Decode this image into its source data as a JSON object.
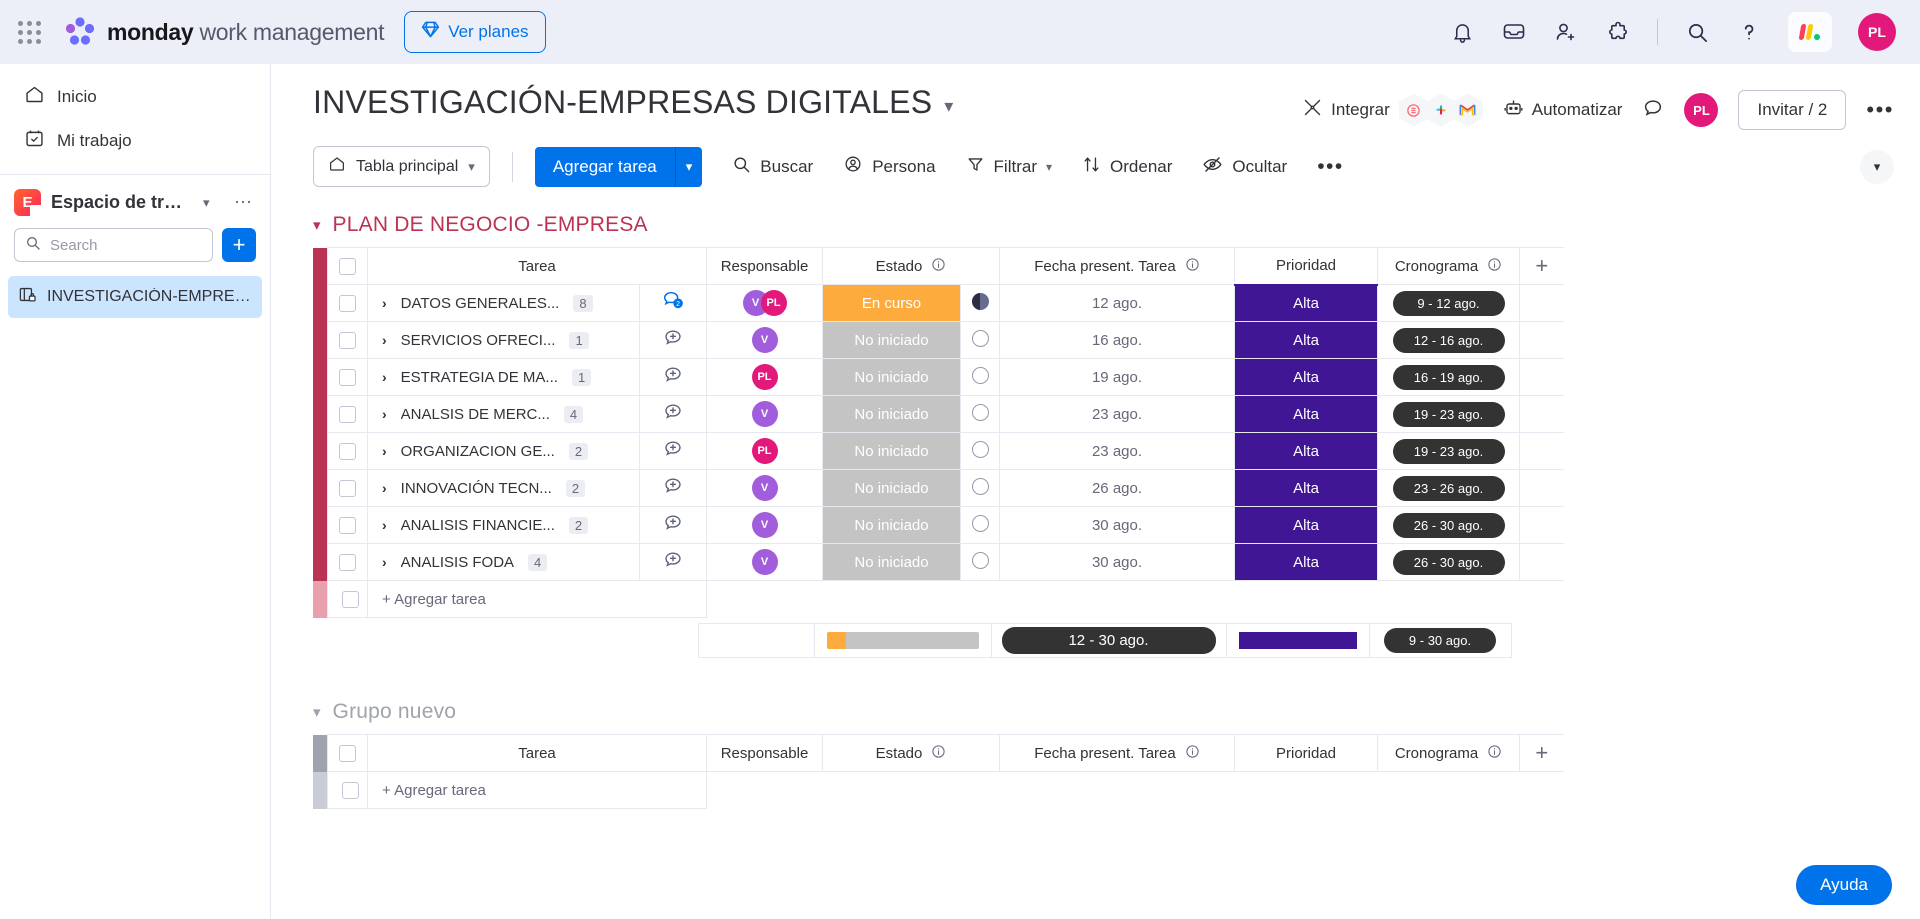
{
  "topbar": {
    "brand_bold": "monday",
    "brand_rest": " work management",
    "plans_label": "Ver planes",
    "icons": [
      "apps-grid-icon",
      "notifications-bell-icon",
      "inbox-icon",
      "invite-member-icon",
      "apps-puzzle-icon",
      "search-icon",
      "help-question-icon",
      "monday-logo-icon"
    ],
    "avatar_initials": "PL",
    "avatar_color": "#e2197a"
  },
  "sidebar": {
    "nav": [
      {
        "label": "Inicio",
        "icon": "home-icon"
      },
      {
        "label": "Mi trabajo",
        "icon": "calendar-check-icon"
      }
    ],
    "workspace": {
      "initial": "E",
      "name": "Espacio de trab...",
      "menu_icon": "more-dots-icon"
    },
    "search": {
      "placeholder": "Search",
      "value": "",
      "icon": "search-icon"
    },
    "add_label": "+",
    "boards": [
      {
        "label": "INVESTIGACIÓN-EMPRESA...",
        "icon": "board-private-icon",
        "selected": true
      }
    ]
  },
  "board": {
    "title": "INVESTIGACIÓN-EMPRESAS DIGITALES",
    "title_chevron": "chevron-down-icon",
    "actions": {
      "integrate": "Integrar",
      "automate": "Automatizar",
      "invite": "Invitar / 2",
      "avatar_initials": "PL",
      "more": "•••"
    }
  },
  "toolbar": {
    "view": "Tabla principal",
    "add_task": "Agregar tarea",
    "items": [
      {
        "label": "Buscar",
        "icon": "search-icon"
      },
      {
        "label": "Persona",
        "icon": "person-icon"
      },
      {
        "label": "Filtrar",
        "icon": "filter-icon",
        "chevron": true
      },
      {
        "label": "Ordenar",
        "icon": "sort-icon"
      },
      {
        "label": "Ocultar",
        "icon": "eye-off-icon"
      }
    ],
    "more": "•••"
  },
  "columns": [
    "Tarea",
    "Responsable",
    "Estado",
    "Fecha present. Tarea",
    "Prioridad",
    "Cronograma"
  ],
  "group1": {
    "name": "PLAN DE NEGOCIO -EMPRESA",
    "color": "#bb3354",
    "add_task": "+ Agregar tarea",
    "rows": [
      {
        "task": "DATOS GENERALES...",
        "subitems": "8",
        "chat": "2",
        "people": [
          {
            "initials": "V",
            "color": "#a25ddc"
          },
          {
            "initials": "PL",
            "color": "#e2197a"
          }
        ],
        "status": "En curso",
        "status_color": "#fdab3d",
        "date": "12 ago.",
        "date_marker": "half",
        "priority": "Alta",
        "priority_color": "#401694",
        "timeline": "9 - 12 ago."
      },
      {
        "task": "SERVICIOS OFRECI...",
        "subitems": "1",
        "chat": "",
        "people": [
          {
            "initials": "V",
            "color": "#a25ddc"
          }
        ],
        "status": "No iniciado",
        "status_color": "#c4c4c4",
        "date": "16 ago.",
        "date_marker": "empty",
        "priority": "Alta",
        "priority_color": "#401694",
        "timeline": "12 - 16 ago."
      },
      {
        "task": "ESTRATEGIA DE MA...",
        "subitems": "1",
        "chat": "",
        "people": [
          {
            "initials": "PL",
            "color": "#e2197a"
          }
        ],
        "status": "No iniciado",
        "status_color": "#c4c4c4",
        "date": "19 ago.",
        "date_marker": "empty",
        "priority": "Alta",
        "priority_color": "#401694",
        "timeline": "16 - 19 ago."
      },
      {
        "task": "ANALSIS DE MERC...",
        "subitems": "4",
        "chat": "",
        "people": [
          {
            "initials": "V",
            "color": "#a25ddc"
          }
        ],
        "status": "No iniciado",
        "status_color": "#c4c4c4",
        "date": "23 ago.",
        "date_marker": "empty",
        "priority": "Alta",
        "priority_color": "#401694",
        "timeline": "19 - 23 ago."
      },
      {
        "task": "ORGANIZACION GE...",
        "subitems": "2",
        "chat": "",
        "people": [
          {
            "initials": "PL",
            "color": "#e2197a"
          }
        ],
        "status": "No iniciado",
        "status_color": "#c4c4c4",
        "date": "23 ago.",
        "date_marker": "empty",
        "priority": "Alta",
        "priority_color": "#401694",
        "timeline": "19 - 23 ago."
      },
      {
        "task": "INNOVACIÓN TECN...",
        "subitems": "2",
        "chat": "",
        "people": [
          {
            "initials": "V",
            "color": "#a25ddc"
          }
        ],
        "status": "No iniciado",
        "status_color": "#c4c4c4",
        "date": "26 ago.",
        "date_marker": "empty",
        "priority": "Alta",
        "priority_color": "#401694",
        "timeline": "23 - 26 ago."
      },
      {
        "task": "ANALISIS FINANCIE...",
        "subitems": "2",
        "chat": "",
        "people": [
          {
            "initials": "V",
            "color": "#a25ddc"
          }
        ],
        "status": "No iniciado",
        "status_color": "#c4c4c4",
        "date": "30 ago.",
        "date_marker": "empty",
        "priority": "Alta",
        "priority_color": "#401694",
        "timeline": "26 - 30 ago."
      },
      {
        "task": "ANALISIS FODA",
        "subitems": "4",
        "chat": "",
        "people": [
          {
            "initials": "V",
            "color": "#a25ddc"
          }
        ],
        "status": "No iniciado",
        "status_color": "#c4c4c4",
        "date": "30 ago.",
        "date_marker": "empty",
        "priority": "Alta",
        "priority_color": "#401694",
        "timeline": "26 - 30 ago."
      }
    ],
    "summary": {
      "status_segments": [
        {
          "color": "#fdab3d",
          "pct": 12.5
        },
        {
          "color": "#c4c4c4",
          "pct": 87.5
        }
      ],
      "date_range": "12 - 30 ago.",
      "priority_color": "#401694",
      "timeline": "9 - 30 ago."
    }
  },
  "group2": {
    "name": "Grupo nuevo",
    "color": "#a0a3ad",
    "add_task": "+ Agregar tarea"
  },
  "help": {
    "label": "Ayuda"
  }
}
